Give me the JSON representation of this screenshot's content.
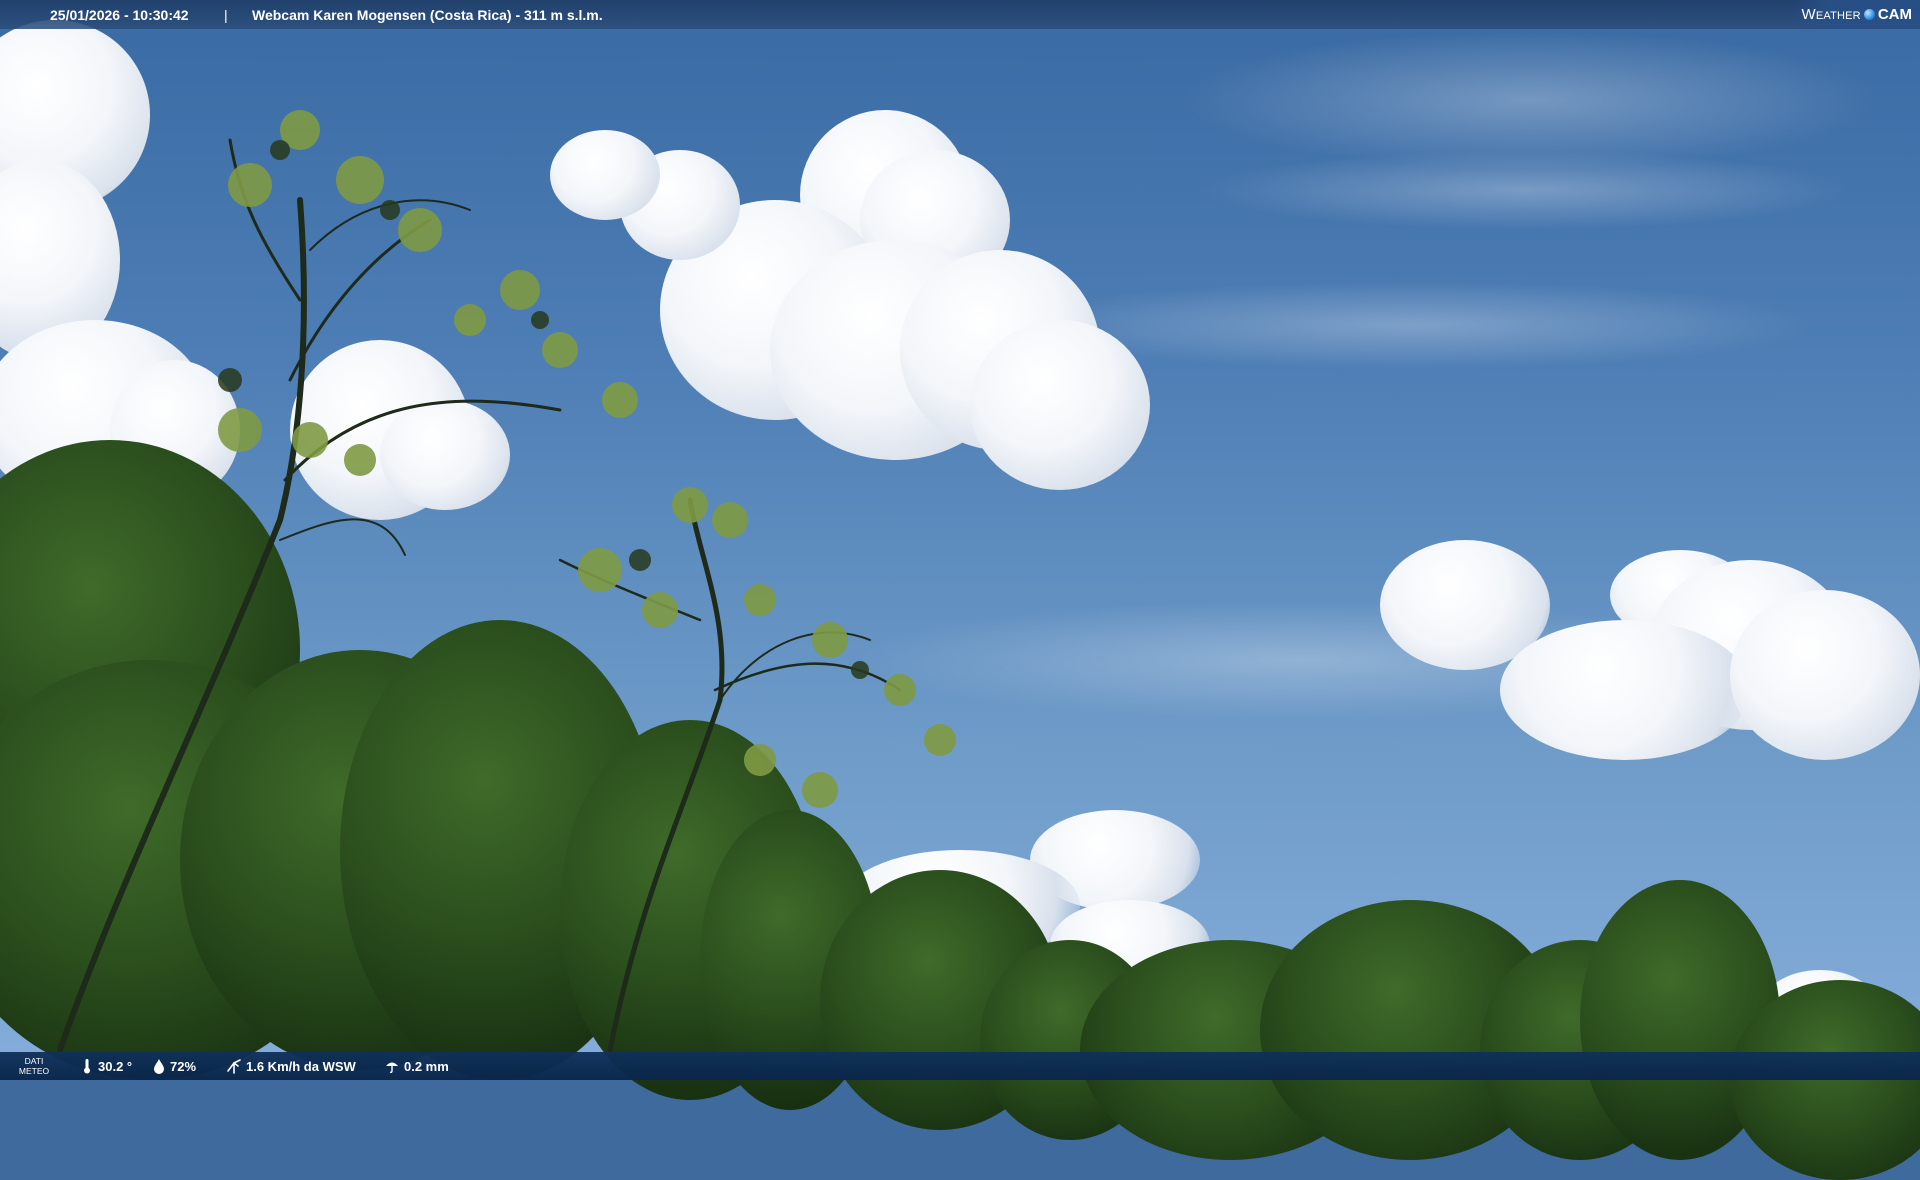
{
  "overlay_top": {
    "datetime": "25/01/2026 - 10:30:42",
    "separator": "|",
    "title": "Webcam Karen Mogensen (Costa Rica) - 311 m s.l.m."
  },
  "brand": {
    "weather": "Weather",
    "cam": "CAM"
  },
  "overlay_bottom": {
    "dati_line1": "DATI",
    "dati_line2": "METEO",
    "temperature": "30.2 °",
    "humidity": "72%",
    "wind": "1.6 Km/h da WSW",
    "rain": "0.2 mm",
    "icons": {
      "temperature": "thermometer-icon",
      "humidity": "droplet-icon",
      "wind": "wind-icon",
      "rain": "rain-icon"
    }
  },
  "colors": {
    "bar_top": "#203e69",
    "bar_bottom": "#0f305a",
    "text": "#ffffff"
  }
}
